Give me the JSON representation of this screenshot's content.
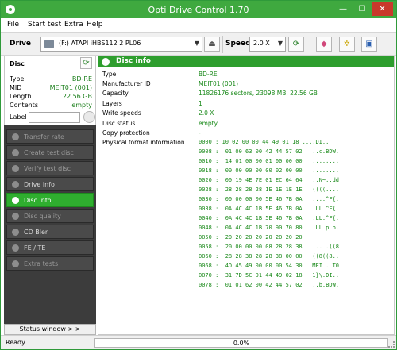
{
  "window": {
    "title": "Opti Drive Control 1.70",
    "minimize": "—",
    "maximize": "☐",
    "close": "✕"
  },
  "menu": [
    "File",
    "Start test",
    "Extra",
    "Help"
  ],
  "toolbar": {
    "drive_label": "Drive",
    "drive_value": "(F:)   ATAPI iHBS112   2 PL06",
    "speed_label": "Speed",
    "speed_value": "2.0 X"
  },
  "disc_panel": {
    "title": "Disc",
    "fields": [
      {
        "label": "Type",
        "value": "BD-RE"
      },
      {
        "label": "MID",
        "value": "MEIT01 (001)"
      },
      {
        "label": "Length",
        "value": "22.56 GB"
      },
      {
        "label": "Contents",
        "value": "empty"
      }
    ],
    "label_field_label": "Label",
    "label_field_value": ""
  },
  "nav": {
    "items": [
      {
        "label": "Transfer rate",
        "state": "dim"
      },
      {
        "label": "Create test disc",
        "state": "dim"
      },
      {
        "label": "Verify test disc",
        "state": "dim"
      },
      {
        "label": "Drive info",
        "state": "normal"
      },
      {
        "label": "Disc info",
        "state": "active"
      },
      {
        "label": "Disc quality",
        "state": "dim"
      },
      {
        "label": "CD Bler",
        "state": "normal"
      },
      {
        "label": "FE / TE",
        "state": "normal"
      },
      {
        "label": "Extra tests",
        "state": "dim"
      }
    ],
    "status_window_button": "Status window > >"
  },
  "disc_info": {
    "title": "Disc info",
    "rows": [
      {
        "label": "Type",
        "value": "BD-RE"
      },
      {
        "label": "Manufacturer ID",
        "value": "MEIT01 (001)"
      },
      {
        "label": "Capacity",
        "value": "11826176 sectors, 23098 MB, 22.56 GB"
      },
      {
        "label": "Layers",
        "value": "1"
      },
      {
        "label": "Write speeds",
        "value": "2.0 X"
      },
      {
        "label": "Disc status",
        "value": "empty"
      },
      {
        "label": "Copy protection",
        "value": "-"
      },
      {
        "label": "Physical format information",
        "value": "0000 :  10 02 00 00 44 49 01 18   ....DI.."
      }
    ],
    "hex_lines": [
      "0008 :  01 00 63 00 42 44 57 02   ..c.BDW.",
      "0010 :  14 01 00 00 01 00 00 00   ........",
      "0018 :  00 00 00 00 00 02 00 00   ........",
      "0020 :  00 19 4E 7E 01 EC 64 64   ..N~..dd",
      "0028 :  28 28 28 28 1E 1E 1E 1E   ((((....",
      "0030 :  00 00 00 00 5E 46 7B 0A   ....^F{.",
      "0038 :  0A 4C 4C 1B 5E 46 7B 0A   .LL.^F{.",
      "0040 :  0A 4C 4C 1B 5E 46 7B 0A   .LL.^F{.",
      "0048 :  0A 4C 4C 1B 70 90 70 80   .LL.p.p.",
      "0050 :  20 20 20 20 20 20 20 20           ",
      "0058 :  20 00 00 00 08 28 28 38    ....((8",
      "0060 :  28 28 38 28 28 38 00 00   ((8((8..",
      "0068 :  4D 45 49 00 00 00 54 30   MEI...T0",
      "0070 :  31 7D 5C 01 44 49 02 18   1}\\.DI..",
      "0078 :  01 01 62 00 42 44 57 02   ..b.BDW."
    ]
  },
  "statusbar": {
    "status": "Ready",
    "progress_text": "0.0%",
    "progress": 0
  },
  "colors": {
    "accent": "#3fa93f",
    "value_text": "#1b8a1b",
    "nav_bg": "#3c3c3c",
    "nav_active": "#2fae2f"
  },
  "icons": [
    "refresh-icon",
    "eject-icon",
    "erase-icon",
    "settings-icon",
    "save-icon",
    "disc-icon"
  ]
}
